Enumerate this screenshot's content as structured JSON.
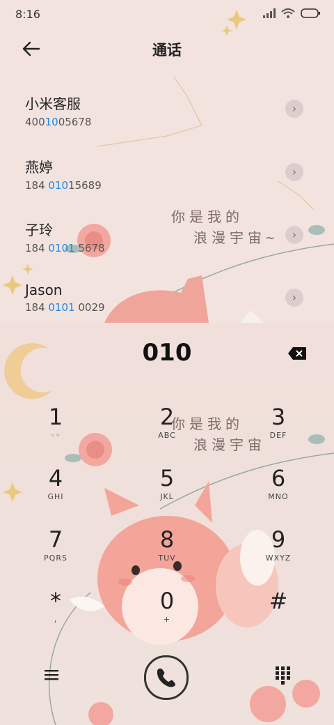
{
  "status": {
    "time": "8:16"
  },
  "header": {
    "title": "通话",
    "back_icon": "arrow-left-icon"
  },
  "contacts": [
    {
      "name": "小米客服",
      "num_pre": "400",
      "num_hl": "10",
      "num_post": "05678"
    },
    {
      "name": "燕婷",
      "num_pre": "184 ",
      "num_hl": "010",
      "num_post": "15689"
    },
    {
      "name": "子玲",
      "num_pre": "184 ",
      "num_hl": "0101",
      "num_post": " 5678"
    },
    {
      "name": "Jason",
      "num_pre": "184 ",
      "num_hl": "0101",
      "num_post": " 0029"
    }
  ],
  "dialed": "010",
  "keys": [
    {
      "d": "1",
      "l": "◦◦"
    },
    {
      "d": "2",
      "l": "ABC"
    },
    {
      "d": "3",
      "l": "DEF"
    },
    {
      "d": "4",
      "l": "GHI"
    },
    {
      "d": "5",
      "l": "JKL"
    },
    {
      "d": "6",
      "l": "MNO"
    },
    {
      "d": "7",
      "l": "PQRS"
    },
    {
      "d": "8",
      "l": "TUV"
    },
    {
      "d": "9",
      "l": "WXYZ"
    },
    {
      "d": "*",
      "l": ","
    },
    {
      "d": "0",
      "l": "+"
    },
    {
      "d": "#",
      "l": ""
    }
  ],
  "wallpaper": {
    "line1": "你是我的",
    "line2": "浪漫宇宙~",
    "line2b": "浪漫宇宙"
  },
  "colors": {
    "accent": "#1e88e5",
    "background": "#f2e3de"
  }
}
